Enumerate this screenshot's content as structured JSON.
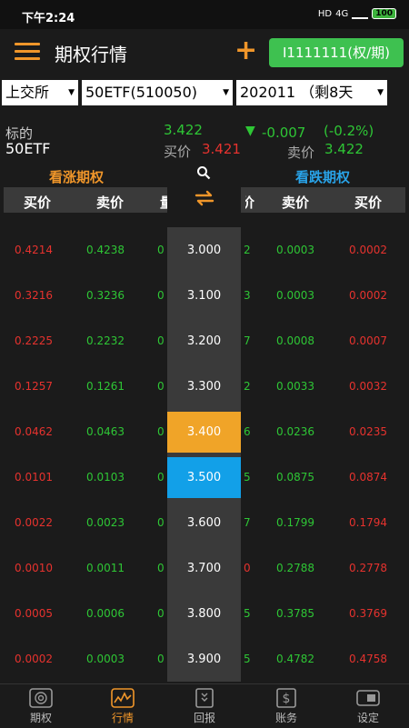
{
  "status_bar": {
    "time": "下午2:24",
    "battery": "100",
    "network": "4G",
    "hd": "HD"
  },
  "header": {
    "title": "期权行情",
    "account": "I1111111(权/期)"
  },
  "selectors": {
    "exchange": "上交所",
    "underlying": "50ETF(510050)",
    "expiry": "202011 （剩8天"
  },
  "quote": {
    "label": "标的",
    "name": "50ETF",
    "price": "3.422",
    "change": "-0.007",
    "change_pct": "(-0.2%)",
    "bid_label": "买价",
    "bid": "3.421",
    "ask_label": "卖价",
    "ask": "3.422"
  },
  "tabs": {
    "call": "看涨期权",
    "put": "看跌期权"
  },
  "columns": {
    "buy": "买价",
    "sell": "卖价",
    "clip_left": "量",
    "clip_right": "价"
  },
  "rows": [
    {
      "call_bid": "0.4214",
      "call_ask": "0.4238",
      "call_clip": "0",
      "strike": "3.000",
      "put_clip": "2",
      "put_ask": "0.0003",
      "put_bid": "0.0002"
    },
    {
      "call_bid": "0.3216",
      "call_ask": "0.3236",
      "call_clip": "0",
      "strike": "3.100",
      "put_clip": "3",
      "put_ask": "0.0003",
      "put_bid": "0.0002"
    },
    {
      "call_bid": "0.2225",
      "call_ask": "0.2232",
      "call_clip": "0",
      "strike": "3.200",
      "put_clip": "7",
      "put_ask": "0.0008",
      "put_bid": "0.0007"
    },
    {
      "call_bid": "0.1257",
      "call_ask": "0.1261",
      "call_clip": "0",
      "strike": "3.300",
      "put_clip": "2",
      "put_ask": "0.0033",
      "put_bid": "0.0032"
    },
    {
      "call_bid": "0.0462",
      "call_ask": "0.0463",
      "call_clip": "0",
      "strike": "3.400",
      "put_clip": "6",
      "put_ask": "0.0236",
      "put_bid": "0.0235"
    },
    {
      "call_bid": "0.0101",
      "call_ask": "0.0103",
      "call_clip": "0",
      "strike": "3.500",
      "put_clip": "5",
      "put_ask": "0.0875",
      "put_bid": "0.0874"
    },
    {
      "call_bid": "0.0022",
      "call_ask": "0.0023",
      "call_clip": "0",
      "strike": "3.600",
      "put_clip": "7",
      "put_ask": "0.1799",
      "put_bid": "0.1794"
    },
    {
      "call_bid": "0.0010",
      "call_ask": "0.0011",
      "call_clip": "0",
      "strike": "3.700",
      "put_clip": "0",
      "put_ask": "0.2788",
      "put_bid": "0.2778"
    },
    {
      "call_bid": "0.0005",
      "call_ask": "0.0006",
      "call_clip": "0",
      "strike": "3.800",
      "put_clip": "5",
      "put_ask": "0.3785",
      "put_bid": "0.3769"
    },
    {
      "call_bid": "0.0002",
      "call_ask": "0.0003",
      "call_clip": "0",
      "strike": "3.900",
      "put_clip": "5",
      "put_ask": "0.4782",
      "put_bid": "0.4758"
    }
  ],
  "nav": {
    "options": "期权",
    "quotes": "行情",
    "report": "回报",
    "account": "账务",
    "settings": "设定"
  },
  "colors": {
    "accent": "#f0962a",
    "up": "#e6322e",
    "down": "#2ec635",
    "atm": "#f0a428",
    "selected": "#12a0e8",
    "account_bg": "#3ec150"
  }
}
